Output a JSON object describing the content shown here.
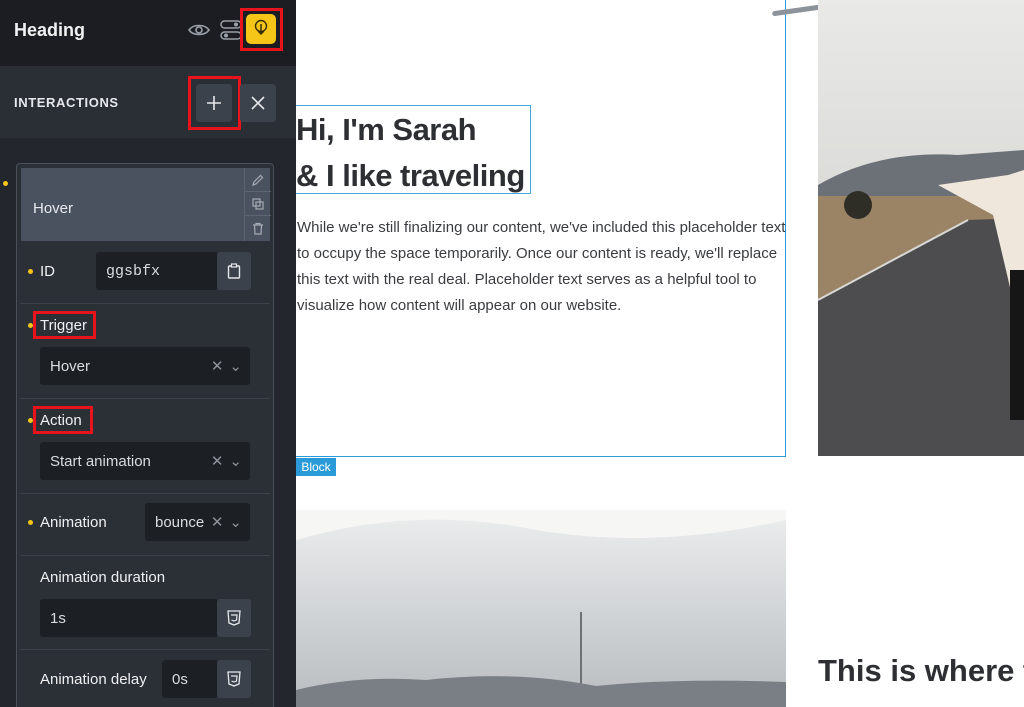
{
  "sidebar": {
    "title": "Heading",
    "interactions_label": "INTERACTIONS",
    "card": {
      "name": "Hover"
    },
    "id": {
      "label": "ID",
      "value": "ggsbfx"
    },
    "trigger": {
      "label": "Trigger",
      "value": "Hover"
    },
    "action": {
      "label": "Action",
      "value": "Start animation"
    },
    "animation": {
      "label": "Animation",
      "value": "bounce"
    },
    "duration": {
      "label": "Animation duration",
      "value": "1s"
    },
    "delay": {
      "label": "Animation delay",
      "value": "0s"
    }
  },
  "canvas": {
    "hero_line1": "Hi, I'm Sarah",
    "hero_line2": "& I like traveling",
    "hero_text": "While we're still finalizing our content, we've included this placeholder text to occupy the space temporarily. Once our content is ready, we'll replace this text with the real deal. Placeholder text serves as a helpful tool to visualize how content will appear on our website.",
    "block_tag": "Block",
    "section_title": "This is where t"
  },
  "colors": {
    "accent": "#f5c518",
    "highlight": "#e8131b",
    "selection": "#2a9bd8",
    "panel_bg": "#23262c"
  }
}
